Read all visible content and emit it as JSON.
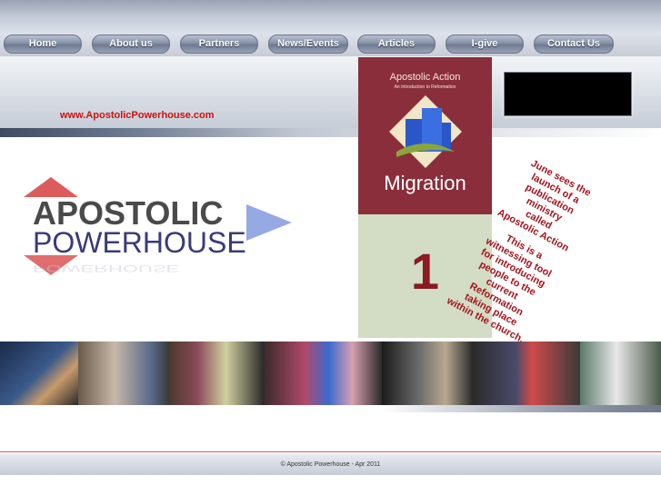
{
  "nav": {
    "items": [
      {
        "label": "Home"
      },
      {
        "label": "About us"
      },
      {
        "label": "Partners"
      },
      {
        "label": "News/Events"
      },
      {
        "label": "Articles"
      },
      {
        "label": "I-give"
      },
      {
        "label": "Contact Us"
      }
    ]
  },
  "header": {
    "url": "www.ApostolicPowerhouse.com"
  },
  "logo": {
    "line1": "APOSTOLIC",
    "line2": "POWERHOUSE",
    "colors": {
      "line1": "#4a4a4a",
      "line2": "#3a3a7a",
      "red": "#d84a4a",
      "blue": "#8aa0e0"
    }
  },
  "book": {
    "title": "Apostolic Action",
    "subtitle": "An Introduction to Reformation",
    "big_word": "Migration",
    "page_number": "1"
  },
  "announcement": {
    "lines": [
      "June sees the",
      "launch of a",
      "publication",
      "ministry",
      "called",
      "Apostolic Action",
      "",
      "This is a",
      "witnessing tool",
      "for introducing",
      "people to the",
      "current",
      "Reformation",
      "taking place",
      "within the church."
    ],
    "color": "#a3141d"
  },
  "footer": {
    "text": "© Apostolic Powerhouse - Apr 2011"
  }
}
